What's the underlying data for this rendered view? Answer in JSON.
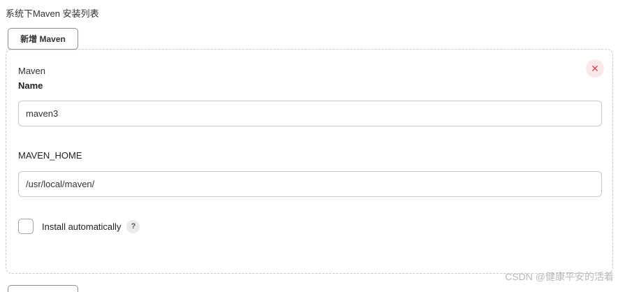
{
  "section": {
    "title": "系统下Maven 安装列表",
    "add_button_label": "新增 Maven"
  },
  "installation": {
    "header": "Maven",
    "close_symbol": "✕",
    "name_label": "Name",
    "name_value": "maven3",
    "home_label": "MAVEN_HOME",
    "home_value": "/usr/local/maven/",
    "install_auto_label": "Install automatically",
    "install_auto_checked": false,
    "help_symbol": "?"
  },
  "watermark": "CSDN @健康平安的活着",
  "colors": {
    "close_bg": "#fbe9ea",
    "close_fg": "#d64545"
  }
}
